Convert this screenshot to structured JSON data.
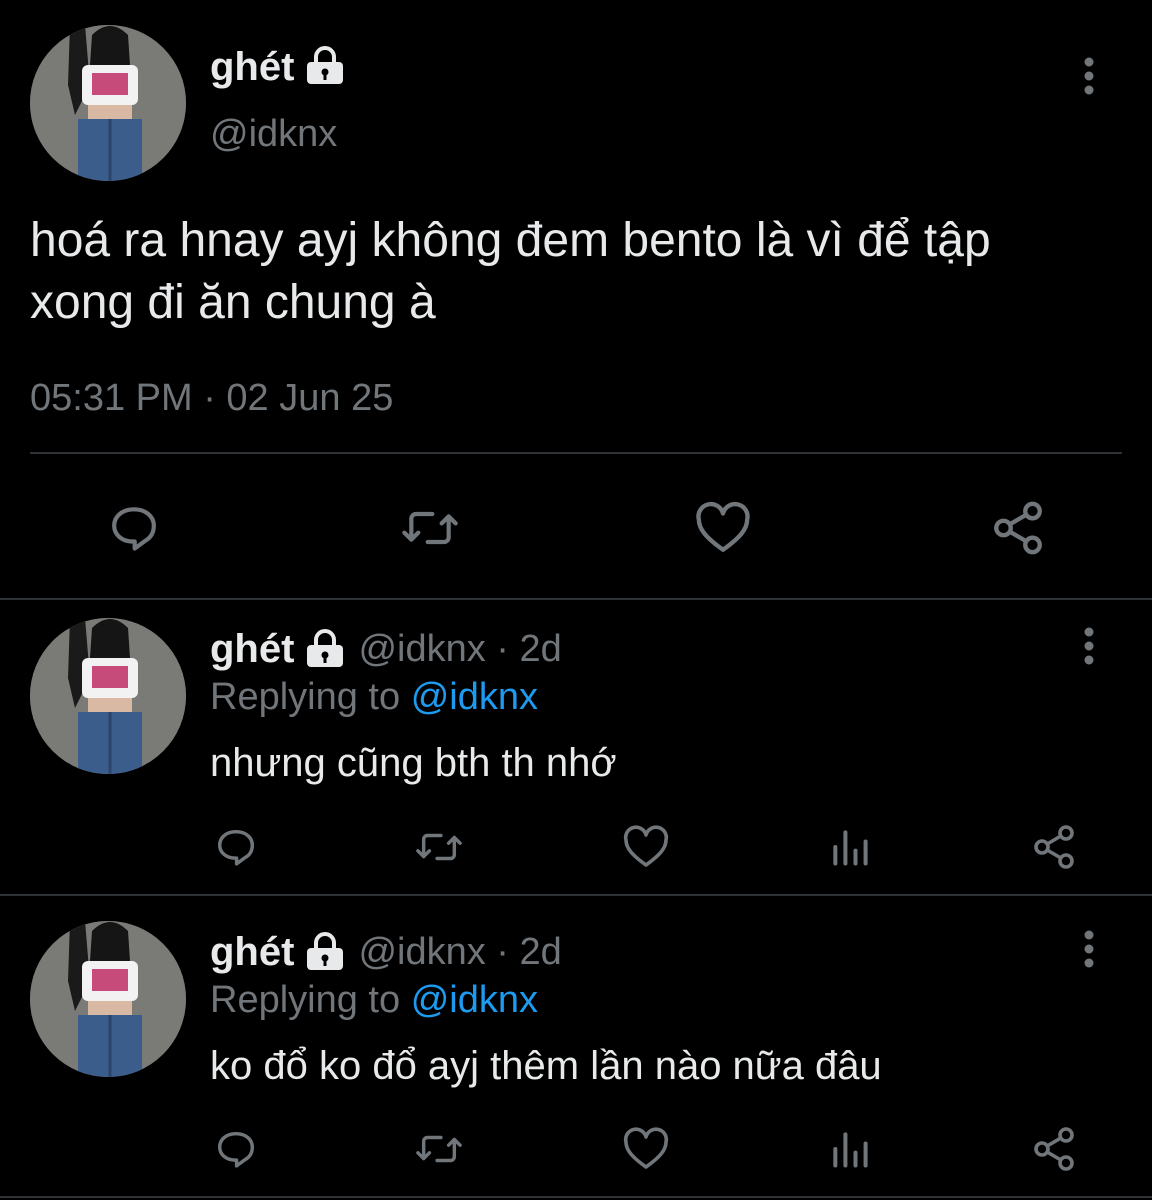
{
  "main_tweet": {
    "display_name": "ghét",
    "handle": "@idknx",
    "text_line1": "hoá ra hnay ayj không đem bento là vì để tập",
    "text_line2": "xong đi ăn chung à",
    "timestamp": "05:31 PM · 02 Jun 25",
    "actions": [
      "reply-icon",
      "retweet-icon",
      "like-icon",
      "share-icon"
    ]
  },
  "replies": [
    {
      "display_name": "ghét",
      "handle_time": "@idknx · 2d",
      "replying_prefix": "Replying to",
      "replying_handle": "@idknx",
      "text": "nhưng cũng bth th nhớ",
      "actions": [
        "reply-icon",
        "retweet-icon",
        "like-icon",
        "views-icon",
        "share-icon"
      ]
    },
    {
      "display_name": "ghét",
      "handle_time": "@idknx · 2d",
      "replying_prefix": "Replying to",
      "replying_handle": "@idknx",
      "text": "ko đổ ko đổ ayj thêm lần nào nữa đâu",
      "actions": [
        "reply-icon",
        "retweet-icon",
        "like-icon",
        "views-icon",
        "share-icon"
      ]
    }
  ],
  "colors": {
    "background": "#000000",
    "text": "#e7e9ea",
    "muted": "#71767b",
    "link": "#1d9bf0",
    "divider": "#2f3336"
  }
}
